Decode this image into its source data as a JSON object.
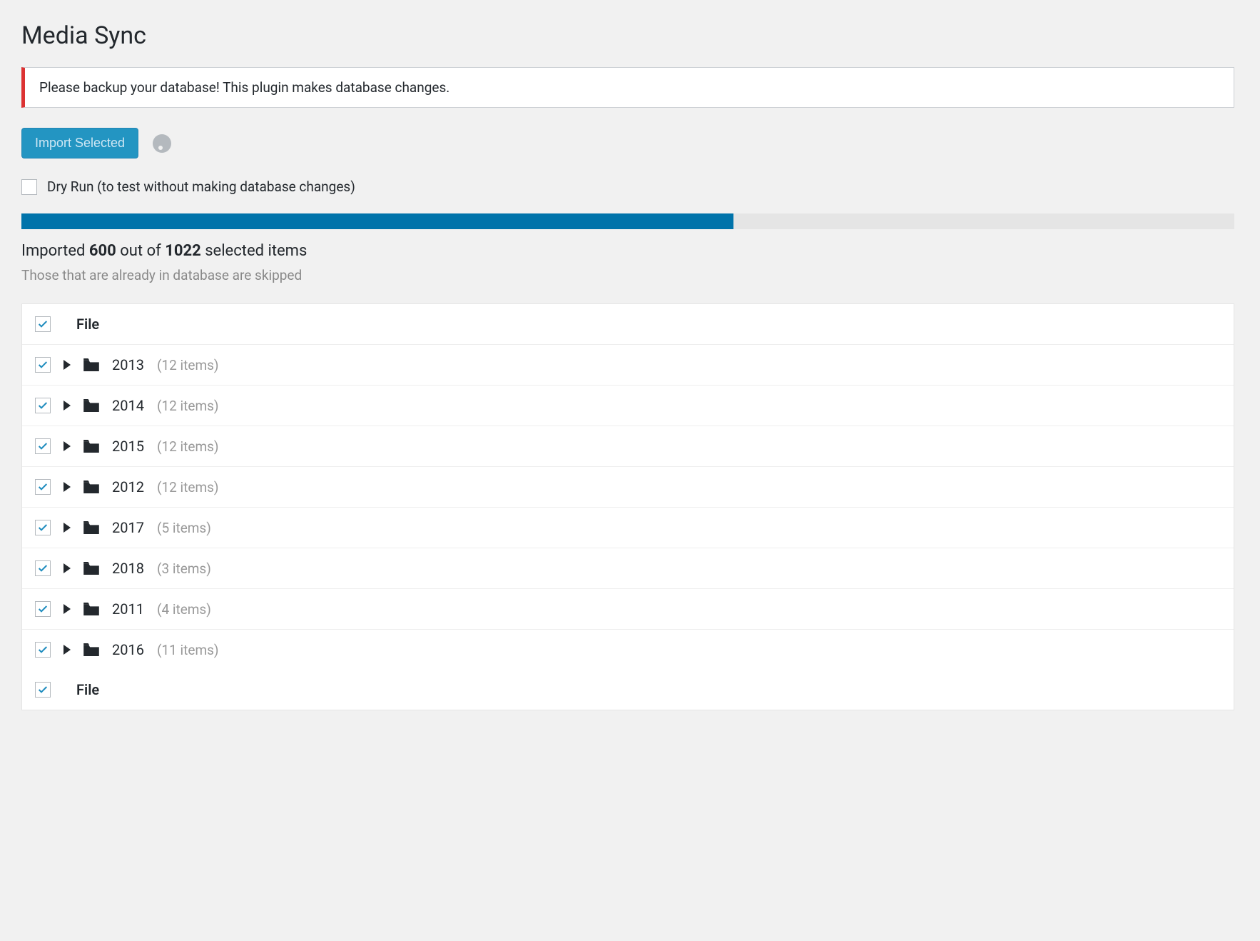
{
  "page": {
    "title": "Media Sync",
    "warning": "Please backup your database! This plugin makes database changes."
  },
  "toolbar": {
    "import_label": "Import Selected"
  },
  "dryrun": {
    "label": "Dry Run (to test without making database changes)",
    "checked": false
  },
  "progress": {
    "imported": 600,
    "total": 1022,
    "percent": 58.7,
    "status_prefix": "Imported ",
    "status_mid": " out of ",
    "status_suffix": " selected items",
    "skip_note": "Those that are already in database are skipped"
  },
  "table": {
    "header_label": "File",
    "footer_label": "File",
    "folders": [
      {
        "name": "2013",
        "count_label": "(12 items)",
        "checked": true
      },
      {
        "name": "2014",
        "count_label": "(12 items)",
        "checked": true
      },
      {
        "name": "2015",
        "count_label": "(12 items)",
        "checked": true
      },
      {
        "name": "2012",
        "count_label": "(12 items)",
        "checked": true
      },
      {
        "name": "2017",
        "count_label": "(5 items)",
        "checked": true
      },
      {
        "name": "2018",
        "count_label": "(3 items)",
        "checked": true
      },
      {
        "name": "2011",
        "count_label": "(4 items)",
        "checked": true
      },
      {
        "name": "2016",
        "count_label": "(11 items)",
        "checked": true
      }
    ]
  },
  "colors": {
    "accent": "#0085ba",
    "progress": "#0073aa",
    "warning_border": "#dc3232"
  }
}
